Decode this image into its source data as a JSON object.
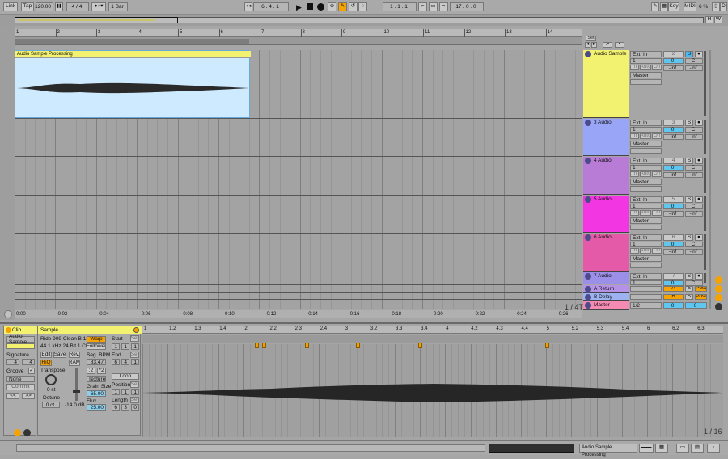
{
  "topbar": {
    "link": "Link",
    "tap": "Tap",
    "tempo": "120.00",
    "metro_icon": "metronome-icon",
    "sig_num": "4",
    "sig_den": "4",
    "quant": "1 Bar",
    "position": "6 . 4 . 1",
    "loop_start": "1 . 1 . 1",
    "loop_len": "17 . 0 . 0",
    "key": "Key",
    "midi": "MIDI",
    "cpu": "6 %",
    "d_label": "D",
    "h_label": "H",
    "w_label": "W"
  },
  "arrangement": {
    "ruler_marks": [
      "1",
      "2",
      "3",
      "4",
      "5",
      "6",
      "7",
      "8",
      "9",
      "10",
      "11",
      "12",
      "13",
      "14"
    ],
    "time_marks": [
      "0:00",
      "0:02",
      "0:04",
      "0:06",
      "0:08",
      "0:10",
      "0:12",
      "0:14",
      "0:16",
      "0:18",
      "0:20",
      "0:22",
      "0:24",
      "0:26"
    ],
    "page_counter": "1 / 4T",
    "clip_name": "Audio Sample Processing",
    "set_label": "Set"
  },
  "tracks": [
    {
      "name": "Audio Sample",
      "color": "#f3f170",
      "input": "Ext. In",
      "channel": "1",
      "output": "Master",
      "number": "2",
      "vol": "0",
      "pan": "C",
      "meter_l": "-inf",
      "meter_r": "-inf"
    },
    {
      "name": "3 Audio",
      "color": "#99a6f7",
      "input": "Ext. In",
      "channel": "1",
      "output": "Master",
      "number": "3",
      "vol": "0",
      "pan": "C",
      "meter_l": "-inf",
      "meter_r": "-inf"
    },
    {
      "name": "4 Audio",
      "color": "#b87cd6",
      "input": "Ext. In",
      "channel": "1",
      "output": "Master",
      "number": "4",
      "vol": "0",
      "pan": "C",
      "meter_l": "-inf",
      "meter_r": "-inf"
    },
    {
      "name": "5 Audio",
      "color": "#f236e1",
      "input": "Ext. In",
      "channel": "1",
      "output": "Master",
      "number": "5",
      "vol": "0",
      "pan": "C",
      "meter_l": "-inf",
      "meter_r": "-inf"
    },
    {
      "name": "6 Audio",
      "color": "#e55aa8",
      "input": "Ext. In",
      "channel": "1",
      "output": "Master",
      "number": "6",
      "vol": "0",
      "pan": "C",
      "meter_l": "-inf",
      "meter_r": "-inf"
    },
    {
      "name": "7 Audio",
      "color": "#9b8fe8",
      "input": "Ext. In",
      "channel": "1",
      "output": "",
      "number": "7",
      "vol": "0",
      "pan": "C",
      "meter_l": "",
      "meter_r": ""
    }
  ],
  "returns": [
    {
      "name": "A Return",
      "color": "#b592e8",
      "letter": "A",
      "s": "S",
      "post": "Post"
    },
    {
      "name": "B Delay",
      "color": "#9db2f0",
      "letter": "B",
      "s": "S",
      "post": "Post"
    }
  ],
  "master": {
    "name": "Master",
    "color": "#f58ab2",
    "output": "1/2",
    "vol": "0",
    "pan": "0"
  },
  "io_labels": {
    "in": "In",
    "auto": "Auto",
    "off": "Off"
  },
  "clip_panel": {
    "header": "Clip",
    "name": "Audio Sample",
    "signature_label": "Signature",
    "sig_num": "4",
    "sig_den": "4",
    "groove_label": "Groove",
    "groove_value": "None",
    "commit": "Commit",
    "nav_left": "<<",
    "nav_right": ">>"
  },
  "sample_panel": {
    "header": "Sample",
    "file": "Ride 909 Clean B 13",
    "info": "44.1 kHz 24 Bit 1 Ch",
    "edit": "Edit",
    "save": "Save",
    "rev": "Rev.",
    "hiq": "HiQ",
    "ram": "RAM",
    "warp": "Warp",
    "seg_bpm_label": "Seg. BPM",
    "seg_bpm": "83.47",
    "half": ":2",
    "double": "*2",
    "mode": "Texture",
    "grain_label": "Grain Size",
    "grain": "65.00",
    "flux_label": "Flux",
    "flux": "25.00",
    "transpose_label": "Transpose",
    "transpose": "0 st",
    "detune_label": "Detune",
    "detune": "0 ct",
    "gain": "-14.0 dB",
    "start_label": "Start",
    "set": "Set",
    "follower": "Follower",
    "start_vals": [
      "1",
      "1",
      "1"
    ],
    "end_label": "End",
    "end_vals": [
      "6",
      "4",
      "1"
    ],
    "loop": "Loop",
    "position_label": "Position",
    "pos_vals": [
      "1",
      "1",
      "1"
    ],
    "length_label": "Length",
    "len_vals": [
      "6",
      "3",
      "0"
    ]
  },
  "sample_editor": {
    "ruler": [
      "1",
      "1.2",
      "1.3",
      "1.4",
      "2",
      "2.2",
      "2.3",
      "2.4",
      "3",
      "3.2",
      "3.3",
      "3.4",
      "4",
      "4.2",
      "4.3",
      "4.4",
      "5",
      "5.2",
      "5.3",
      "5.4",
      "6",
      "6.2",
      "6.3"
    ],
    "page": "1 / 16"
  },
  "status": {
    "clip_name": "Audio Sample Processing"
  }
}
